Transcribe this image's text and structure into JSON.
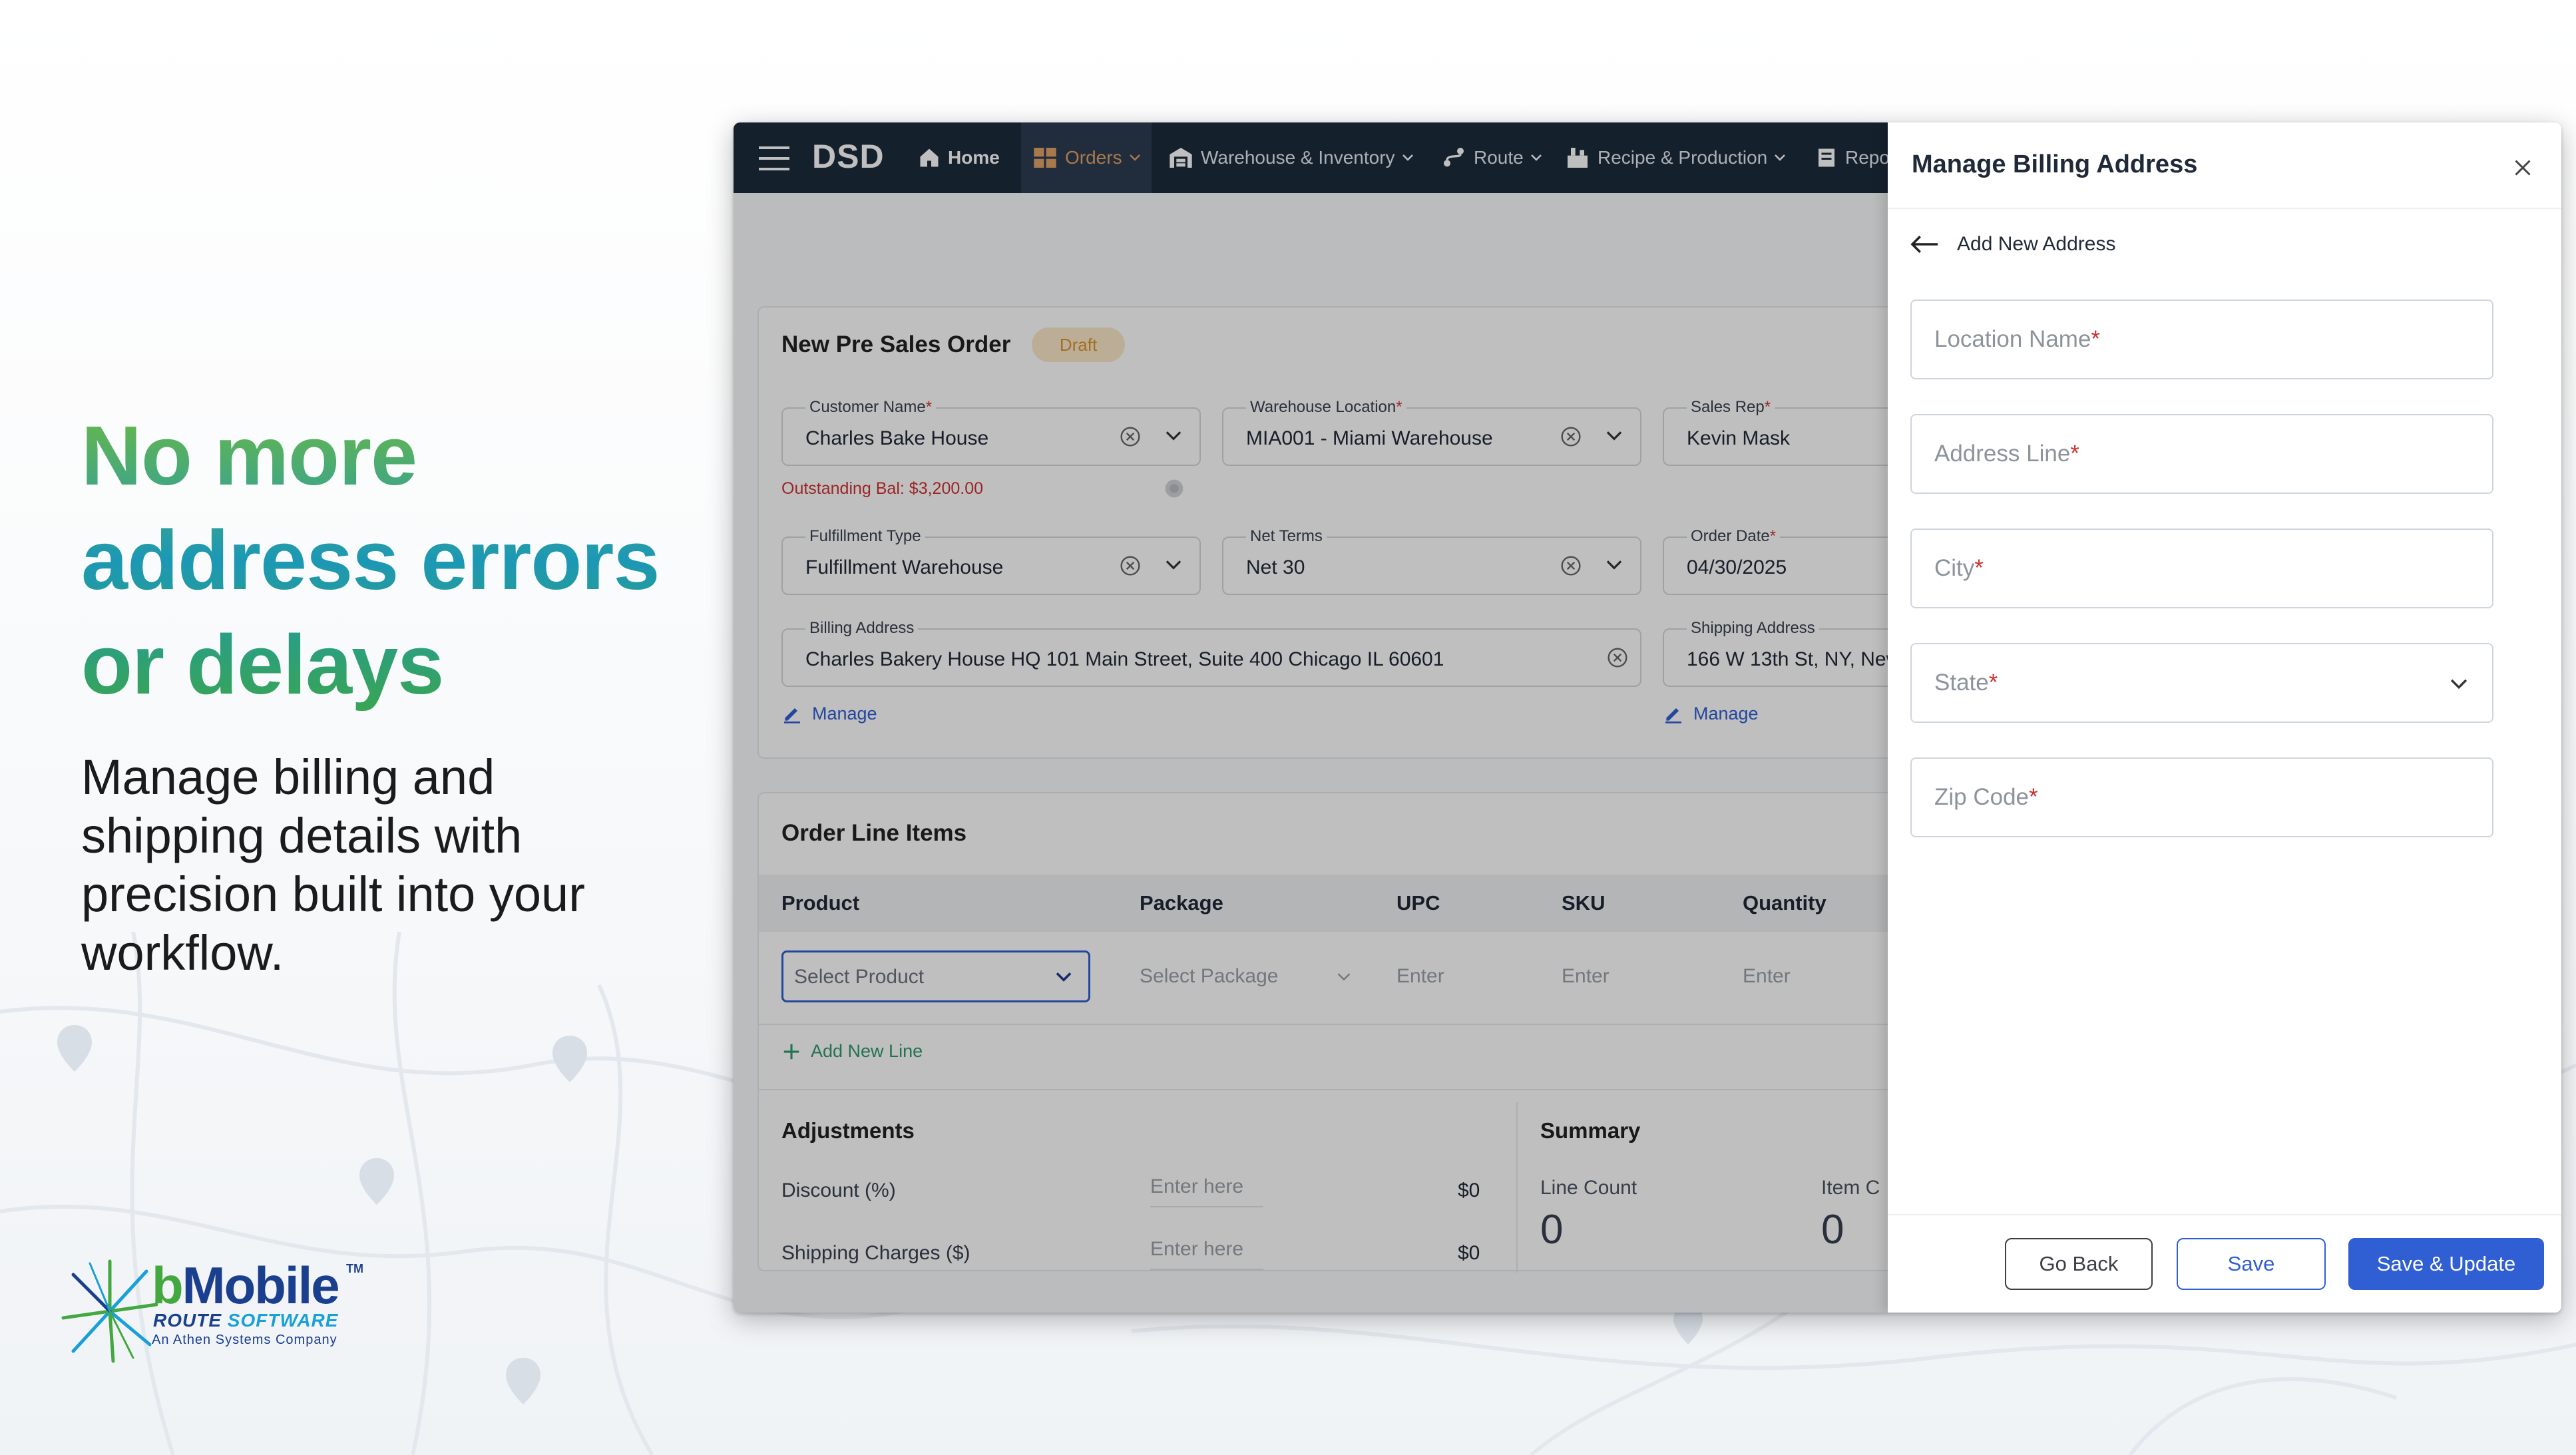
{
  "marketing": {
    "headline": "No more address errors or delays",
    "subtext": "Manage billing and shipping details with precision built into your workflow.",
    "logo": {
      "name_part1": "b",
      "name_part2": "Mobile",
      "trademark": "TM",
      "line2_part1": "ROUTE",
      "line2_part2": "SOFTWARE",
      "line3": "An Athen Systems Company"
    }
  },
  "nav": {
    "brand": "DSD",
    "items": [
      {
        "label": "Home",
        "icon": "home-icon"
      },
      {
        "label": "Orders",
        "icon": "orders-icon",
        "active": true
      },
      {
        "label": "Warehouse & Inventory",
        "icon": "warehouse-icon"
      },
      {
        "label": "Route",
        "icon": "route-icon"
      },
      {
        "label": "Recipe & Production",
        "icon": "recipe-icon"
      },
      {
        "label": "Repo",
        "icon": "reports-icon"
      }
    ]
  },
  "order": {
    "title": "New Pre Sales Order",
    "status": "Draft",
    "customer_name": {
      "label": "Customer Name",
      "value": "Charles Bake House"
    },
    "outstanding": "Outstanding Bal: $3,200.00",
    "warehouse": {
      "label": "Warehouse Location",
      "value": "MIA001 - Miami Warehouse"
    },
    "sales_rep": {
      "label": "Sales Rep",
      "value": "Kevin Mask"
    },
    "fulfillment": {
      "label": "Fulfillment Type",
      "value": "Fulfillment Warehouse"
    },
    "net_terms": {
      "label": "Net Terms",
      "value": "Net 30"
    },
    "order_date": {
      "label": "Order Date",
      "value": "04/30/2025"
    },
    "billing": {
      "label": "Billing Address",
      "value": "Charles Bakery House HQ 101 Main Street, Suite 400 Chicago IL 60601",
      "manage": "Manage"
    },
    "shipping": {
      "label": "Shipping Address",
      "value": "166 W 13th St, NY, New",
      "manage": "Manage"
    }
  },
  "line_items": {
    "title": "Order Line Items",
    "columns": [
      "Product",
      "Package",
      "UPC",
      "SKU",
      "Quantity"
    ],
    "row": {
      "product_placeholder": "Select Product",
      "package_placeholder": "Select Package",
      "upc": "Enter",
      "sku": "Enter",
      "qty": "Enter"
    },
    "add_line": "Add New Line"
  },
  "adjustments": {
    "title": "Adjustments",
    "rows": [
      {
        "label": "Discount (%)",
        "placeholder": "Enter here",
        "amount": "$0"
      },
      {
        "label": "Shipping Charges ($)",
        "placeholder": "Enter here",
        "amount": "$0"
      }
    ]
  },
  "summary": {
    "title": "Summary",
    "line_count_label": "Line Count",
    "line_count": "0",
    "item_label": "Item C",
    "item_value": "0"
  },
  "panel": {
    "title": "Manage Billing Address",
    "back_label": "Add New Address",
    "fields": [
      {
        "placeholder": "Location Name"
      },
      {
        "placeholder": "Address Line"
      },
      {
        "placeholder": "City"
      },
      {
        "placeholder": "State"
      },
      {
        "placeholder": "Zip Code"
      }
    ],
    "required_mark": "*",
    "buttons": {
      "go_back": "Go Back",
      "save": "Save",
      "save_update": "Save & Update"
    }
  },
  "colors": {
    "nav_bg": "#1d2b3d",
    "accent_blue": "#2f5fd3",
    "green": "#2e9a6b",
    "orange_active": "#e0a266",
    "required": "#d03232"
  }
}
